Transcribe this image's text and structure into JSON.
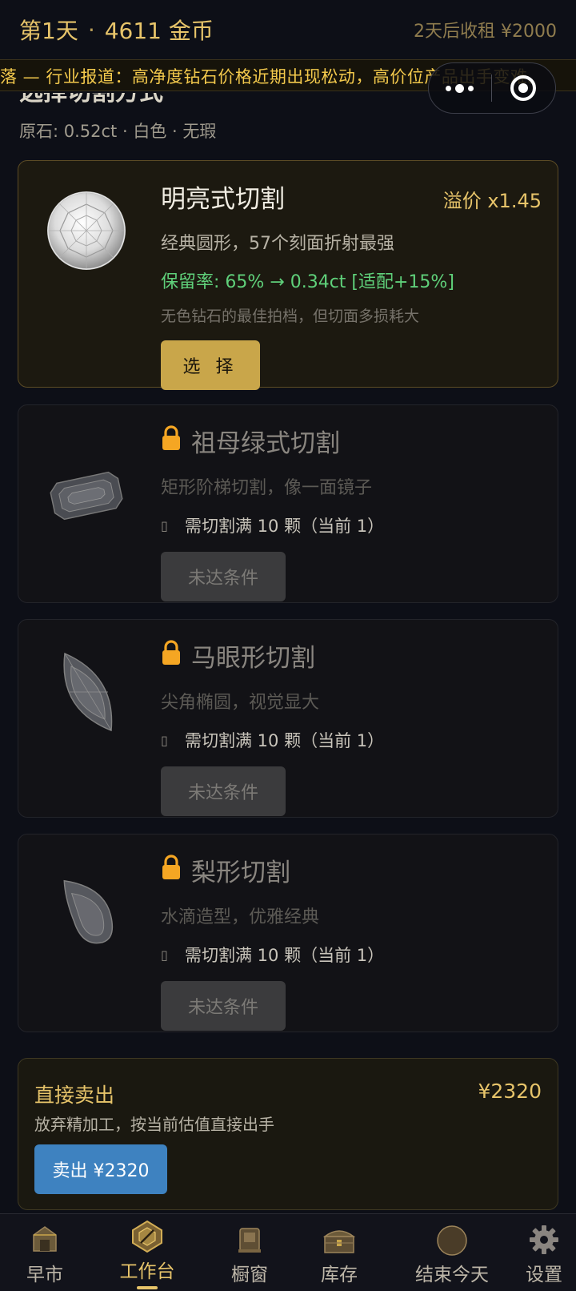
{
  "status": {
    "day": "第1天",
    "coins": "4611 金币",
    "rent": "2天后收租 ¥2000"
  },
  "ticker": "落 — 行业报道：高净度钻石价格近期出现松动，高价位产品出手变难。",
  "section": {
    "title": "选择切割方式",
    "stone_info": "原石: 0.52ct · 白色 · 无瑕"
  },
  "cuts": [
    {
      "icon": "round-brilliant-diamond",
      "title": "明亮式切割",
      "premium": "溢价 x1.45",
      "desc": "经典圆形，57个刻面折射最强",
      "retain": "保留率: 65% → 0.34ct [适配+15%]",
      "note": "无色钻石的最佳拍档，但切面多损耗大",
      "button": "选 择",
      "locked": false
    },
    {
      "icon": "emerald-cut-diamond",
      "title": "祖母绿式切割",
      "desc": "矩形阶梯切割，像一面镜子",
      "req_glyph": "▯",
      "requirement": "需切割满 10 颗（当前 1）",
      "button": "未达条件",
      "locked": true
    },
    {
      "icon": "marquise-cut-diamond",
      "title": "马眼形切割",
      "desc": "尖角椭圆，视觉显大",
      "req_glyph": "▯",
      "requirement": "需切割满 10 颗（当前 1）",
      "button": "未达条件",
      "locked": true
    },
    {
      "icon": "pear-cut-diamond",
      "title": "梨形切割",
      "desc": "水滴造型，优雅经典",
      "req_glyph": "▯",
      "requirement": "需切割满 10 颗（当前 1）",
      "button": "未达条件",
      "locked": true
    }
  ],
  "sell": {
    "title": "直接卖出",
    "price": "¥2320",
    "desc": "放弃精加工，按当前估值直接出手",
    "button": "卖出 ¥2320"
  },
  "nav": [
    {
      "label": "早市",
      "icon": "market-icon",
      "active": false
    },
    {
      "label": "工作台",
      "icon": "workbench-icon",
      "active": true
    },
    {
      "label": "橱窗",
      "icon": "showcase-icon",
      "active": false
    },
    {
      "label": "库存",
      "icon": "inventory-chest-icon",
      "active": false
    },
    {
      "label": "结束今天",
      "icon": "moon-end-day-icon",
      "active": false
    },
    {
      "label": "设置",
      "icon": "gear-icon",
      "active": false
    }
  ],
  "colors": {
    "gold": "#e7c46a",
    "green": "#5fd07a",
    "sell_blue": "#3e82c0",
    "lock_orange": "#f5a623"
  }
}
